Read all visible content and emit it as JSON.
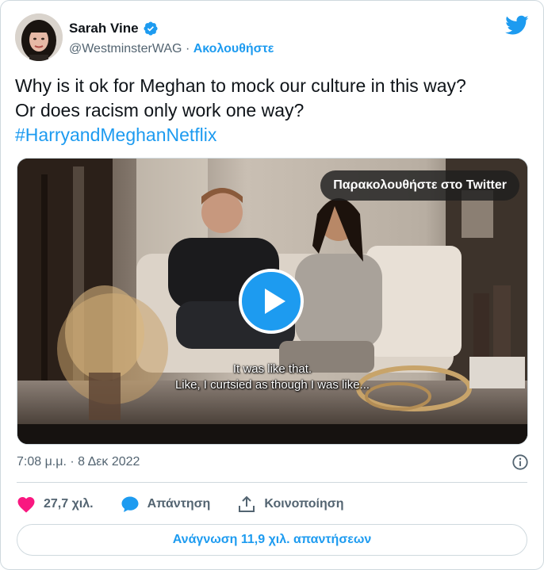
{
  "colors": {
    "accent": "#1d9bf0",
    "text_primary": "#0f1419",
    "text_secondary": "#536471",
    "like_heart": "#f91880",
    "border": "#cfd9de"
  },
  "author": {
    "name": "Sarah Vine",
    "handle": "@WestminsterWAG",
    "separator": "·",
    "follow_label": "Ακολουθήστε",
    "verified_icon": "verified-badge-icon",
    "avatar": "avatar-photo"
  },
  "brand_icon": "twitter-bird-icon",
  "tweet": {
    "line1": "Why is it ok for Meghan to mock our culture in this way?",
    "line2": "Or does racism only work one way?",
    "hashtag": "#HarryandMeghanNetflix"
  },
  "media": {
    "watch_label": "Παρακολουθήστε στο Twitter",
    "play_icon": "play-icon",
    "subtitle_line1": "It was like that.",
    "subtitle_line2": "Like, I curtsied as though I was like..."
  },
  "timestamp": "7:08 μ.μ. · 8 Δεκ 2022",
  "info_icon": "info-icon",
  "actions": {
    "likes_count": "27,7 χιλ.",
    "reply_label": "Απάντηση",
    "share_label": "Κοινοποίηση"
  },
  "read_replies_label": "Ανάγνωση 11,9 χιλ. απαντήσεων"
}
